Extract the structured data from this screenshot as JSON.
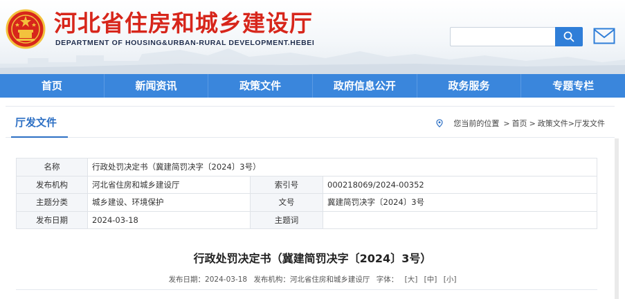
{
  "header": {
    "title": "河北省住房和城乡建设厅",
    "subtitle": "DEPARTMENT OF HOUSING&URBAN-RURAL DEVELOPMENT.HEBEI",
    "search_placeholder": "",
    "search_icon": "search-icon",
    "mail_icon": "mail-icon"
  },
  "colors": {
    "brand_red": "#d7261b",
    "nav_blue": "#3a86dc",
    "accent_blue": "#2c6fc4"
  },
  "nav": [
    "首页",
    "新闻资讯",
    "政策文件",
    "政府信息公开",
    "政务服务",
    "专题专栏"
  ],
  "section": {
    "title": "厅发文件",
    "location_label": "您当前的位置",
    "sep": ">",
    "home": "首页",
    "path": "政策文件>厅发文件"
  },
  "info": {
    "name_label": "名称",
    "name_value": "行政处罚决定书（冀建简罚决字〔2024〕3号）",
    "org_label": "发布机构",
    "org_value": "河北省住房和城乡建设厅",
    "index_label": "索引号",
    "index_value": "000218069/2024-00352",
    "topic_label": "主题分类",
    "topic_value": "城乡建设、环境保护",
    "docno_label": "文号",
    "docno_value": "冀建简罚决字〔2024〕3号",
    "date_label": "发布日期",
    "date_value": "2024-03-18",
    "keyword_label": "主题词",
    "keyword_value": ""
  },
  "doc": {
    "title": "行政处罚决定书（冀建简罚决字〔2024〕3号）",
    "meta_date": "发布日期：2024-03-18",
    "meta_org": "发布机构：河北省住房和城乡建设厅",
    "font_label": "字体：",
    "font_large": "[大]",
    "font_medium": "[中]",
    "font_small": "[小]"
  }
}
